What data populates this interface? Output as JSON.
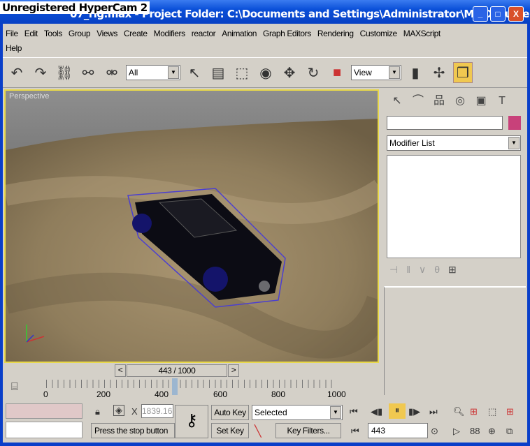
{
  "watermark": "Unregistered HyperCam 2",
  "window": {
    "title": "07_rig.max    - Project Folder: C:\\Documents and Settings\\Administrator\\My Document...",
    "min": "_",
    "max": "□",
    "close": "X"
  },
  "menu": [
    "File",
    "Edit",
    "Tools",
    "Group",
    "Views",
    "Create",
    "Modifiers",
    "reactor",
    "Animation",
    "Graph Editors",
    "Rendering",
    "Customize",
    "MAXScript",
    "Help"
  ],
  "toolbar": {
    "selection_filter": "All",
    "ref_coord": "View"
  },
  "viewport": {
    "label": "Perspective"
  },
  "command_panel": {
    "name_field": "",
    "color": "#c8417a",
    "modifier_list": "Modifier List"
  },
  "time_slider": {
    "value": "443 / 1000",
    "prev": "<",
    "next": ">",
    "current": 443,
    "max": 1000
  },
  "track": {
    "ticks": [
      "0",
      "200",
      "400",
      "600",
      "800",
      "1000"
    ]
  },
  "bottom": {
    "x_field": "1839.16",
    "status": "Press the stop button",
    "auto_key": "Auto Key",
    "set_key": "Set Key",
    "key_mode": "Selected",
    "key_filters": "Key Filters...",
    "frame": "443"
  }
}
